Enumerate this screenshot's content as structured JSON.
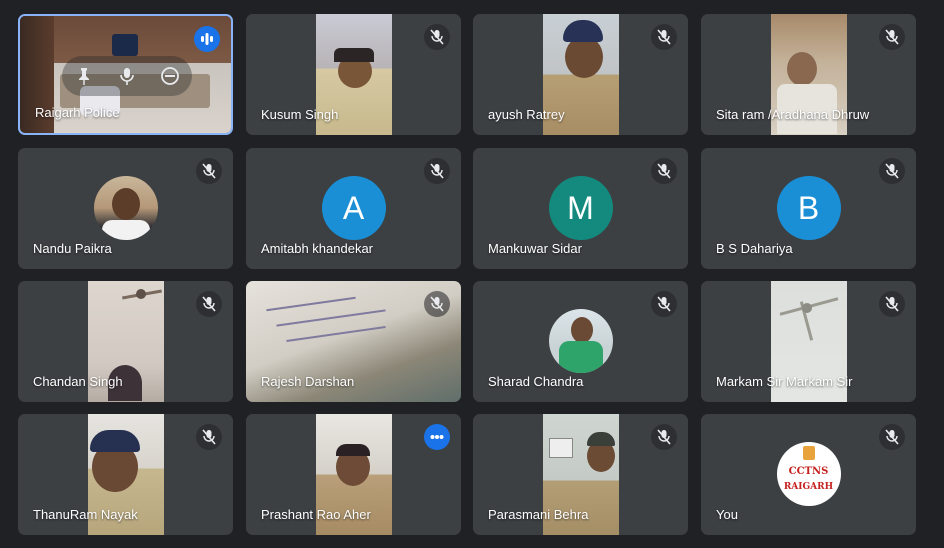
{
  "participants": [
    {
      "name": "Raigarh Police",
      "status": "speaking",
      "video": "room"
    },
    {
      "name": "Kusum Singh",
      "status": "muted",
      "video": "officer-woman"
    },
    {
      "name": "ayush Ratrey",
      "status": "muted",
      "video": "officer-cap"
    },
    {
      "name": "Sita ram /Aradhana Dhruw",
      "status": "muted",
      "video": "room-window"
    },
    {
      "name": "Nandu Paikra",
      "status": "muted",
      "avatar": "photo"
    },
    {
      "name": "Amitabh khandekar",
      "status": "muted",
      "initial": "A",
      "avatar_color": "#1a8fd6"
    },
    {
      "name": "Mankuwar Sidar",
      "status": "muted",
      "initial": "M",
      "avatar_color": "#138a7d"
    },
    {
      "name": "B S Dahariya",
      "status": "muted",
      "initial": "B",
      "avatar_color": "#1a8fd6"
    },
    {
      "name": "Chandan Singh",
      "status": "muted",
      "video": "ceiling-fan-person"
    },
    {
      "name": "Rajesh Darshan",
      "status": "muted",
      "video": "paper-closeup"
    },
    {
      "name": "Sharad Chandra",
      "status": "muted",
      "avatar": "photo-green-shirt"
    },
    {
      "name": "Markam Sir Markam Sir",
      "status": "muted",
      "video": "ceiling-fan"
    },
    {
      "name": "ThanuRam Nayak",
      "status": "muted",
      "video": "officer-cap"
    },
    {
      "name": "Prashant Rao Aher",
      "status": "speaking",
      "video": "officer-seated"
    },
    {
      "name": "Parasmani Behra",
      "status": "muted",
      "video": "officer-room"
    },
    {
      "name": "You",
      "status": "muted",
      "logo": {
        "line1": "CCTNS",
        "line2": "RAIGARH"
      }
    }
  ]
}
